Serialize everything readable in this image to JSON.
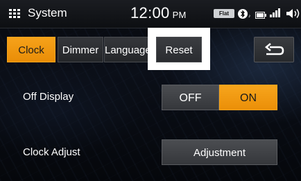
{
  "status_bar": {
    "app_title": "System",
    "time": "12:00",
    "ampm": "PM",
    "eq_badge": "Flat",
    "icons": [
      "menu-grid-icon",
      "bluetooth-icon",
      "battery-icon",
      "signal-bars-icon",
      "volume-icon"
    ]
  },
  "tabs": [
    {
      "label": "Clock",
      "active": true
    },
    {
      "label": "Dimmer",
      "active": false
    },
    {
      "label": "Language",
      "active": false
    },
    {
      "label": "Reset",
      "active": false,
      "highlighted": true
    }
  ],
  "back_button": {
    "icon": "back-arrow-icon"
  },
  "settings": {
    "off_display": {
      "label": "Off Display",
      "options": [
        "OFF",
        "ON"
      ],
      "selected": "ON"
    },
    "clock_adjust": {
      "label": "Clock Adjust",
      "button_label": "Adjustment"
    }
  },
  "colors": {
    "accent": "#f29a10",
    "button_gray": "#3f4145",
    "highlight_frame": "#ffffff"
  }
}
